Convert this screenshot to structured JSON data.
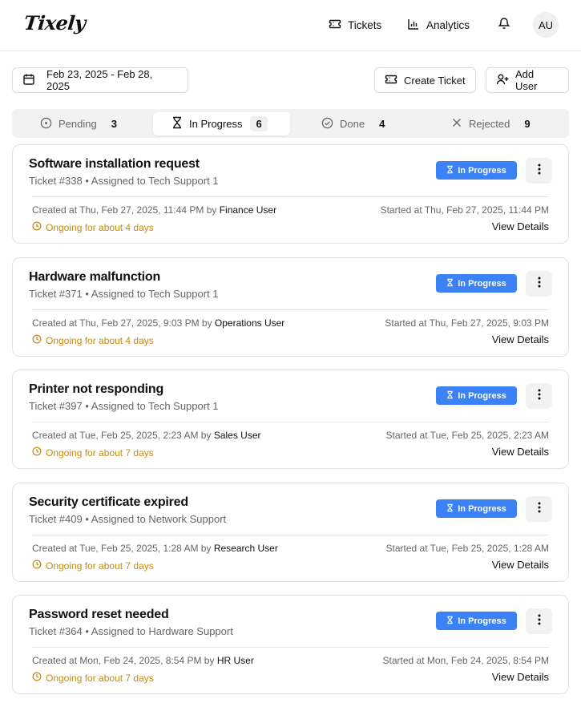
{
  "header": {
    "logo": "Tixely",
    "nav": {
      "tickets": "Tickets",
      "analytics": "Analytics"
    },
    "avatar": "AU"
  },
  "toolbar": {
    "date_range": "Feb 23, 2025 - Feb 28, 2025",
    "create_label": "Create Ticket",
    "add_user_label": "Add User"
  },
  "tabs": [
    {
      "label": "Pending",
      "count": "3",
      "icon": "clock-icon"
    },
    {
      "label": "In Progress",
      "count": "6",
      "icon": "hourglass-icon",
      "active": true
    },
    {
      "label": "Done",
      "count": "4",
      "icon": "check-circle-icon"
    },
    {
      "label": "Rejected",
      "count": "9",
      "icon": "x-icon"
    }
  ],
  "colors": {
    "accent": "#3b82f6",
    "ongoing": "#c98a12"
  },
  "tickets": [
    {
      "title": "Software installation request",
      "subtitle": "Ticket #338 • Assigned to Tech Support 1",
      "status": "In Progress",
      "created_prefix": "Created at Thu, Feb 27, 2025, 11:44 PM by ",
      "created_by": "Finance User",
      "ongoing": "Ongoing for about 4 days",
      "started": "Started at Thu, Feb 27, 2025, 11:44 PM",
      "view": "View Details"
    },
    {
      "title": "Hardware malfunction",
      "subtitle": "Ticket #371 • Assigned to Tech Support 1",
      "status": "In Progress",
      "created_prefix": "Created at Thu, Feb 27, 2025, 9:03 PM by ",
      "created_by": "Operations User",
      "ongoing": "Ongoing for about 4 days",
      "started": "Started at Thu, Feb 27, 2025, 9:03 PM",
      "view": "View Details"
    },
    {
      "title": "Printer not responding",
      "subtitle": "Ticket #397 • Assigned to Tech Support 1",
      "status": "In Progress",
      "created_prefix": "Created at Tue, Feb 25, 2025, 2:23 AM by ",
      "created_by": "Sales User",
      "ongoing": "Ongoing for about 7 days",
      "started": "Started at Tue, Feb 25, 2025, 2:23 AM",
      "view": "View Details"
    },
    {
      "title": "Security certificate expired",
      "subtitle": "Ticket #409 • Assigned to Network Support",
      "status": "In Progress",
      "created_prefix": "Created at Tue, Feb 25, 2025, 1:28 AM by ",
      "created_by": "Research User",
      "ongoing": "Ongoing for about 7 days",
      "started": "Started at Tue, Feb 25, 2025, 1:28 AM",
      "view": "View Details"
    },
    {
      "title": "Password reset needed",
      "subtitle": "Ticket #364 • Assigned to Hardware Support",
      "status": "In Progress",
      "created_prefix": "Created at Mon, Feb 24, 2025, 8:54 PM by ",
      "created_by": "HR User",
      "ongoing": "Ongoing for about 7 days",
      "started": "Started at Mon, Feb 24, 2025, 8:54 PM",
      "view": "View Details"
    }
  ]
}
